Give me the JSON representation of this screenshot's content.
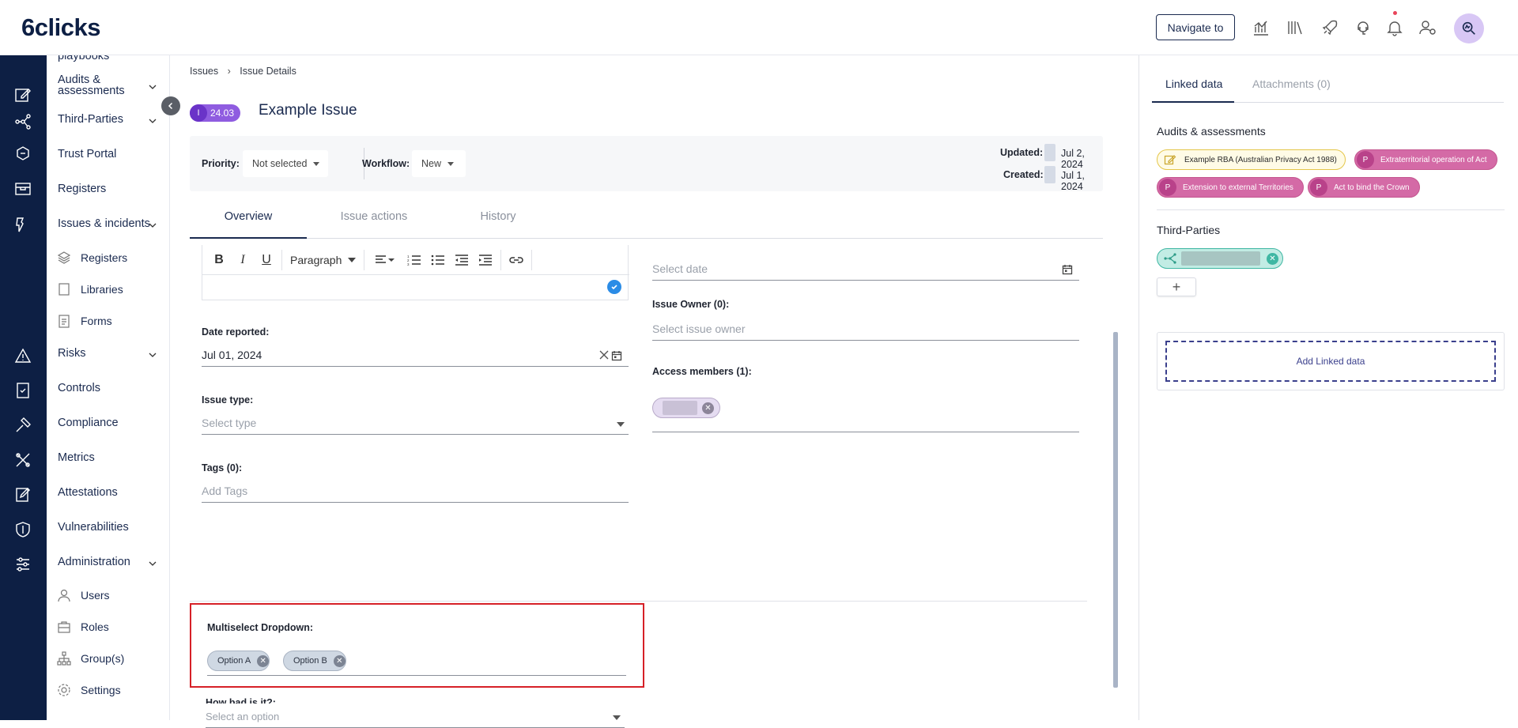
{
  "app": {
    "logo": "6clicks",
    "navigate_label": "Navigate to"
  },
  "top_icons": [
    "analytics-icon",
    "library-icon",
    "rocket-icon",
    "headset-icon",
    "bell-icon",
    "user-settings-icon"
  ],
  "sidebar": {
    "items": [
      {
        "label": "playbooks"
      },
      {
        "label": "Audits & assessments"
      },
      {
        "label": "Third-Parties"
      },
      {
        "label": "Trust Portal"
      },
      {
        "label": "Registers"
      },
      {
        "label": "Issues & incidents"
      },
      {
        "label": "Risks"
      },
      {
        "label": "Controls"
      },
      {
        "label": "Compliance"
      },
      {
        "label": "Metrics"
      },
      {
        "label": "Attestations"
      },
      {
        "label": "Vulnerabilities"
      },
      {
        "label": "Administration"
      }
    ],
    "sub_issues": [
      {
        "label": "Registers"
      },
      {
        "label": "Libraries"
      },
      {
        "label": "Forms"
      }
    ],
    "sub_admin": [
      {
        "label": "Users"
      },
      {
        "label": "Roles"
      },
      {
        "label": "Group(s)"
      },
      {
        "label": "Settings"
      }
    ]
  },
  "breadcrumb": {
    "root": "Issues",
    "current": "Issue Details"
  },
  "issue": {
    "badge_letter": "I",
    "badge_number": "24.03",
    "title": "Example Issue"
  },
  "meta": {
    "priority_label": "Priority:",
    "priority_value": "Not selected",
    "workflow_label": "Workflow:",
    "workflow_value": "New",
    "updated_label": "Updated:",
    "updated_value": "Jul 2, 2024",
    "created_label": "Created:",
    "created_value": "Jul 1, 2024"
  },
  "tabs": [
    {
      "label": "Overview"
    },
    {
      "label": "Issue actions"
    },
    {
      "label": "History"
    }
  ],
  "editor": {
    "paragraph": "Paragraph"
  },
  "form": {
    "date_reported_label": "Date reported:",
    "date_reported_value": "Jul 01, 2024",
    "issue_type_label": "Issue type:",
    "issue_type_placeholder": "Select type",
    "tags_label": "Tags (0):",
    "tags_placeholder": "Add Tags",
    "select_date_placeholder": "Select date",
    "owner_label": "Issue Owner (0):",
    "owner_placeholder": "Select issue owner",
    "access_label": "Access members (1):",
    "multiselect_label": "Multiselect Dropdown:",
    "multiselect_options": [
      "Option A",
      "Option B"
    ],
    "how_bad_label": "How bad is it?:",
    "how_bad_placeholder": "Select an option"
  },
  "right": {
    "tab_linked": "Linked data",
    "tab_attach": "Attachments (0)",
    "audits_title": "Audits & assessments",
    "audit_tags": [
      {
        "label": "Example RBA (Australian Privacy Act 1988)",
        "kind": "audit"
      },
      {
        "label": "Extraterritorial operation of Act",
        "kind": "P"
      },
      {
        "label": "Extension to external Territories",
        "kind": "P"
      },
      {
        "label": "Act to bind the Crown",
        "kind": "P"
      }
    ],
    "third_parties_title": "Third-Parties",
    "plus": "+",
    "add_linked": "Add Linked data"
  }
}
